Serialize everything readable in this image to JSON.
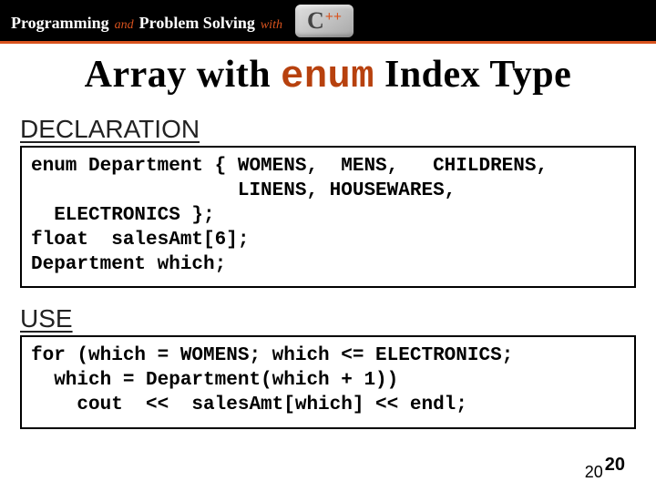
{
  "topbar": {
    "word1": "Programming",
    "and": "and",
    "word2": "Problem Solving",
    "with": "with",
    "cpp_c": "C",
    "cpp_pp": "++"
  },
  "title": {
    "pre": "Array with ",
    "enum": "enum",
    "post": " Index Type"
  },
  "sections": {
    "declaration_label": "DECLARATION",
    "declaration_code": "enum Department { WOMENS,  MENS,   CHILDRENS,\n                  LINENS, HOUSEWARES,\n  ELECTRONICS };\nfloat  salesAmt[6];\nDepartment which;",
    "use_label": "USE",
    "use_code": "for (which = WOMENS; which <= ELECTRONICS;\n  which = Department(which + 1))\n    cout  <<  salesAmt[which] << endl;"
  },
  "page": {
    "small": "20",
    "big": "20"
  }
}
